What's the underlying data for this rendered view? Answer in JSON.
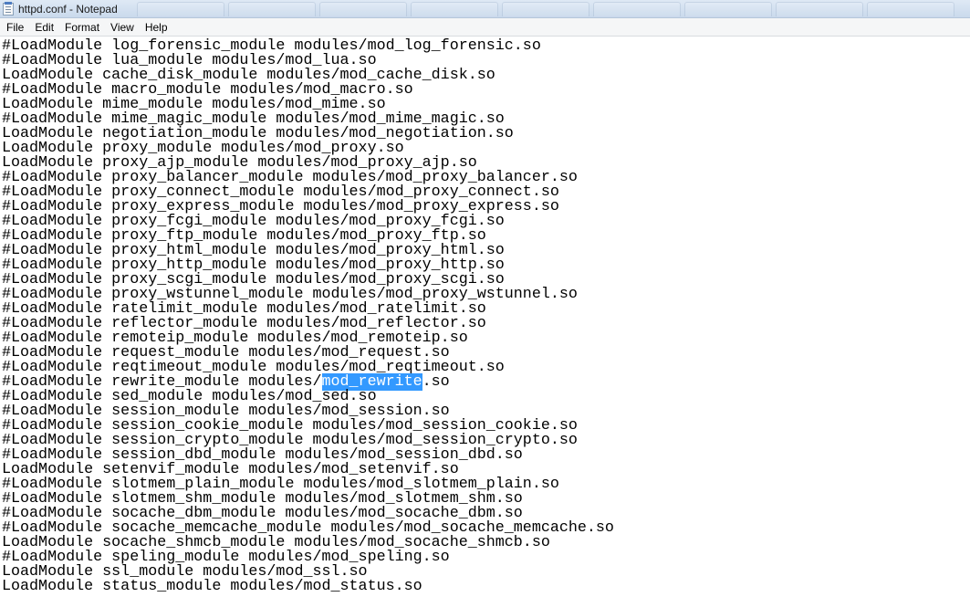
{
  "window": {
    "title": "httpd.conf - Notepad",
    "icon": "notepad-icon"
  },
  "menu": [
    "File",
    "Edit",
    "Format",
    "View",
    "Help"
  ],
  "editor": {
    "lines": [
      "#LoadModule log_forensic_module modules/mod_log_forensic.so",
      "#LoadModule lua_module modules/mod_lua.so",
      "LoadModule cache_disk_module modules/mod_cache_disk.so",
      "#LoadModule macro_module modules/mod_macro.so",
      "LoadModule mime_module modules/mod_mime.so",
      "#LoadModule mime_magic_module modules/mod_mime_magic.so",
      "LoadModule negotiation_module modules/mod_negotiation.so",
      "LoadModule proxy_module modules/mod_proxy.so",
      "LoadModule proxy_ajp_module modules/mod_proxy_ajp.so",
      "#LoadModule proxy_balancer_module modules/mod_proxy_balancer.so",
      "#LoadModule proxy_connect_module modules/mod_proxy_connect.so",
      "#LoadModule proxy_express_module modules/mod_proxy_express.so",
      "#LoadModule proxy_fcgi_module modules/mod_proxy_fcgi.so",
      "#LoadModule proxy_ftp_module modules/mod_proxy_ftp.so",
      "#LoadModule proxy_html_module modules/mod_proxy_html.so",
      "#LoadModule proxy_http_module modules/mod_proxy_http.so",
      "#LoadModule proxy_scgi_module modules/mod_proxy_scgi.so",
      "#LoadModule proxy_wstunnel_module modules/mod_proxy_wstunnel.so",
      "#LoadModule ratelimit_module modules/mod_ratelimit.so",
      "#LoadModule reflector_module modules/mod_reflector.so",
      "#LoadModule remoteip_module modules/mod_remoteip.so",
      "#LoadModule request_module modules/mod_request.so",
      "#LoadModule reqtimeout_module modules/mod_reqtimeout.so",
      "#LoadModule rewrite_module modules/mod_rewrite.so",
      "#LoadModule sed_module modules/mod_sed.so",
      "#LoadModule session_module modules/mod_session.so",
      "#LoadModule session_cookie_module modules/mod_session_cookie.so",
      "#LoadModule session_crypto_module modules/mod_session_crypto.so",
      "#LoadModule session_dbd_module modules/mod_session_dbd.so",
      "LoadModule setenvif_module modules/mod_setenvif.so",
      "#LoadModule slotmem_plain_module modules/mod_slotmem_plain.so",
      "#LoadModule slotmem_shm_module modules/mod_slotmem_shm.so",
      "#LoadModule socache_dbm_module modules/mod_socache_dbm.so",
      "#LoadModule socache_memcache_module modules/mod_socache_memcache.so",
      "LoadModule socache_shmcb_module modules/mod_socache_shmcb.so",
      "#LoadModule speling_module modules/mod_speling.so",
      "LoadModule ssl_module modules/mod_ssl.so",
      "LoadModule status_module modules/mod_status.so"
    ],
    "selection": {
      "line_index": 23,
      "text": "mod_rewrite",
      "color": "#3399ff"
    }
  }
}
